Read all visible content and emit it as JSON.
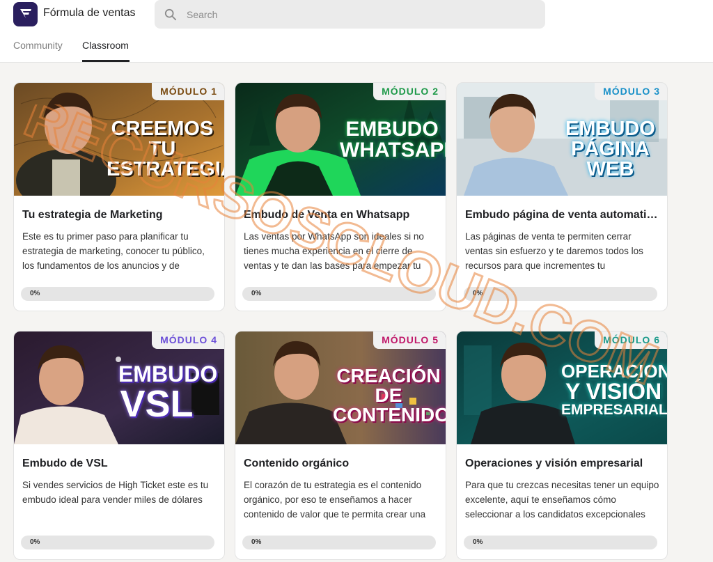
{
  "app": {
    "title": "Fórmula de ventas"
  },
  "search": {
    "placeholder": "Search",
    "value": ""
  },
  "tabs": [
    {
      "label": "Community",
      "active": false
    },
    {
      "label": "Classroom",
      "active": true
    }
  ],
  "courses": [
    {
      "badge": "MÓDULO 1",
      "badge_color": "#7a4a10",
      "headline": [
        "CREEMOS TU",
        "ESTRATEGIA"
      ],
      "title": "Tu estrategia de Marketing",
      "description": "Este es tu primer paso para planificar tu estrategia de marketing, conocer tu público, los fundamentos de los anuncios y de",
      "progress": 0,
      "progress_label": "0%"
    },
    {
      "badge": "MÓDULO 2",
      "badge_color": "#1f9a4a",
      "headline": [
        "EMBUDO",
        "WHATSAPP"
      ],
      "title": "Embudo de Venta en Whatsapp",
      "description": "Las ventas por WhatsApp son ideales si no tienes mucha experiencia en el cierre de ventas y te dan las bases para empezar tu",
      "progress": 0,
      "progress_label": "0%"
    },
    {
      "badge": "MÓDULO 3",
      "badge_color": "#1890c8",
      "headline": [
        "EMBUDO",
        "PÁGINA WEB"
      ],
      "title": "Embudo página de venta automatizada",
      "description": "Las páginas de venta te permiten cerrar ventas sin esfuerzo y te daremos todos los recursos para que incrementes tu",
      "progress": 0,
      "progress_label": "0%"
    },
    {
      "badge": "MÓDULO 4",
      "badge_color": "#6b4fd8",
      "headline": [
        "EMBUDO",
        "VSL"
      ],
      "title": "Embudo de VSL",
      "description": "Si vendes servicios de High Ticket este es tu embudo ideal para vender miles de dólares",
      "progress": 0,
      "progress_label": "0%"
    },
    {
      "badge": "MÓDULO 5",
      "badge_color": "#c0186a",
      "headline": [
        "CREACIÓN DE",
        "CONTENIDO"
      ],
      "title": "Contenido orgánico",
      "description": "El corazón de tu estrategia es el contenido orgánico, por eso te enseñamos a hacer contenido de valor que te permita crear una",
      "progress": 0,
      "progress_label": "0%"
    },
    {
      "badge": "MÓDULO 6",
      "badge_color": "#1a9a8a",
      "headline": [
        "OPERACIONES",
        "Y VISIÓN",
        "EMPRESARIAL"
      ],
      "title": "Operaciones y visión empresarial",
      "description": "Para que tu crezcas necesitas tener un equipo excelente, aquí te enseñamos cómo seleccionar a los candidatos excepcionales",
      "progress": 0,
      "progress_label": "0%"
    }
  ],
  "watermark": {
    "text": "RECURSOSCLOUD.COM"
  }
}
